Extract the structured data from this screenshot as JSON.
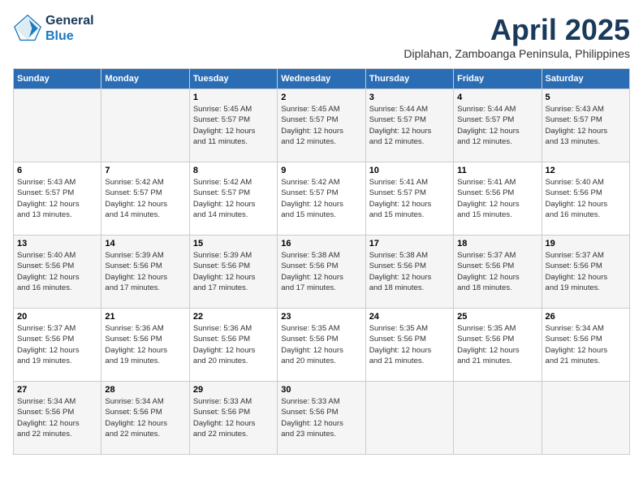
{
  "header": {
    "logo_line1": "General",
    "logo_line2": "Blue",
    "month_title": "April 2025",
    "subtitle": "Diplahan, Zamboanga Peninsula, Philippines"
  },
  "weekdays": [
    "Sunday",
    "Monday",
    "Tuesday",
    "Wednesday",
    "Thursday",
    "Friday",
    "Saturday"
  ],
  "weeks": [
    [
      {
        "day": "",
        "info": ""
      },
      {
        "day": "",
        "info": ""
      },
      {
        "day": "1",
        "info": "Sunrise: 5:45 AM\nSunset: 5:57 PM\nDaylight: 12 hours\nand 11 minutes."
      },
      {
        "day": "2",
        "info": "Sunrise: 5:45 AM\nSunset: 5:57 PM\nDaylight: 12 hours\nand 12 minutes."
      },
      {
        "day": "3",
        "info": "Sunrise: 5:44 AM\nSunset: 5:57 PM\nDaylight: 12 hours\nand 12 minutes."
      },
      {
        "day": "4",
        "info": "Sunrise: 5:44 AM\nSunset: 5:57 PM\nDaylight: 12 hours\nand 12 minutes."
      },
      {
        "day": "5",
        "info": "Sunrise: 5:43 AM\nSunset: 5:57 PM\nDaylight: 12 hours\nand 13 minutes."
      }
    ],
    [
      {
        "day": "6",
        "info": "Sunrise: 5:43 AM\nSunset: 5:57 PM\nDaylight: 12 hours\nand 13 minutes."
      },
      {
        "day": "7",
        "info": "Sunrise: 5:42 AM\nSunset: 5:57 PM\nDaylight: 12 hours\nand 14 minutes."
      },
      {
        "day": "8",
        "info": "Sunrise: 5:42 AM\nSunset: 5:57 PM\nDaylight: 12 hours\nand 14 minutes."
      },
      {
        "day": "9",
        "info": "Sunrise: 5:42 AM\nSunset: 5:57 PM\nDaylight: 12 hours\nand 15 minutes."
      },
      {
        "day": "10",
        "info": "Sunrise: 5:41 AM\nSunset: 5:57 PM\nDaylight: 12 hours\nand 15 minutes."
      },
      {
        "day": "11",
        "info": "Sunrise: 5:41 AM\nSunset: 5:56 PM\nDaylight: 12 hours\nand 15 minutes."
      },
      {
        "day": "12",
        "info": "Sunrise: 5:40 AM\nSunset: 5:56 PM\nDaylight: 12 hours\nand 16 minutes."
      }
    ],
    [
      {
        "day": "13",
        "info": "Sunrise: 5:40 AM\nSunset: 5:56 PM\nDaylight: 12 hours\nand 16 minutes."
      },
      {
        "day": "14",
        "info": "Sunrise: 5:39 AM\nSunset: 5:56 PM\nDaylight: 12 hours\nand 17 minutes."
      },
      {
        "day": "15",
        "info": "Sunrise: 5:39 AM\nSunset: 5:56 PM\nDaylight: 12 hours\nand 17 minutes."
      },
      {
        "day": "16",
        "info": "Sunrise: 5:38 AM\nSunset: 5:56 PM\nDaylight: 12 hours\nand 17 minutes."
      },
      {
        "day": "17",
        "info": "Sunrise: 5:38 AM\nSunset: 5:56 PM\nDaylight: 12 hours\nand 18 minutes."
      },
      {
        "day": "18",
        "info": "Sunrise: 5:37 AM\nSunset: 5:56 PM\nDaylight: 12 hours\nand 18 minutes."
      },
      {
        "day": "19",
        "info": "Sunrise: 5:37 AM\nSunset: 5:56 PM\nDaylight: 12 hours\nand 19 minutes."
      }
    ],
    [
      {
        "day": "20",
        "info": "Sunrise: 5:37 AM\nSunset: 5:56 PM\nDaylight: 12 hours\nand 19 minutes."
      },
      {
        "day": "21",
        "info": "Sunrise: 5:36 AM\nSunset: 5:56 PM\nDaylight: 12 hours\nand 19 minutes."
      },
      {
        "day": "22",
        "info": "Sunrise: 5:36 AM\nSunset: 5:56 PM\nDaylight: 12 hours\nand 20 minutes."
      },
      {
        "day": "23",
        "info": "Sunrise: 5:35 AM\nSunset: 5:56 PM\nDaylight: 12 hours\nand 20 minutes."
      },
      {
        "day": "24",
        "info": "Sunrise: 5:35 AM\nSunset: 5:56 PM\nDaylight: 12 hours\nand 21 minutes."
      },
      {
        "day": "25",
        "info": "Sunrise: 5:35 AM\nSunset: 5:56 PM\nDaylight: 12 hours\nand 21 minutes."
      },
      {
        "day": "26",
        "info": "Sunrise: 5:34 AM\nSunset: 5:56 PM\nDaylight: 12 hours\nand 21 minutes."
      }
    ],
    [
      {
        "day": "27",
        "info": "Sunrise: 5:34 AM\nSunset: 5:56 PM\nDaylight: 12 hours\nand 22 minutes."
      },
      {
        "day": "28",
        "info": "Sunrise: 5:34 AM\nSunset: 5:56 PM\nDaylight: 12 hours\nand 22 minutes."
      },
      {
        "day": "29",
        "info": "Sunrise: 5:33 AM\nSunset: 5:56 PM\nDaylight: 12 hours\nand 22 minutes."
      },
      {
        "day": "30",
        "info": "Sunrise: 5:33 AM\nSunset: 5:56 PM\nDaylight: 12 hours\nand 23 minutes."
      },
      {
        "day": "",
        "info": ""
      },
      {
        "day": "",
        "info": ""
      },
      {
        "day": "",
        "info": ""
      }
    ]
  ]
}
